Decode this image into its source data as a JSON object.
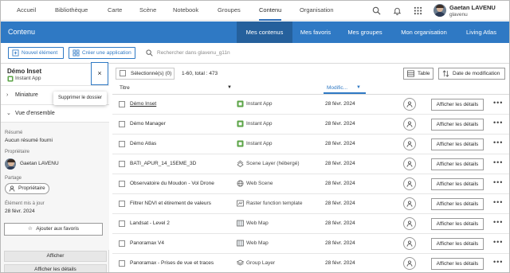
{
  "topnav": {
    "items": [
      {
        "label": "Accueil"
      },
      {
        "label": "Bibliothèque"
      },
      {
        "label": "Carte"
      },
      {
        "label": "Scène"
      },
      {
        "label": "Notebook"
      },
      {
        "label": "Groupes"
      },
      {
        "label": "Contenu"
      },
      {
        "label": "Organisation"
      }
    ],
    "active": "Contenu",
    "user_name": "Gaetan LAVENU",
    "user_org": "glavenu",
    "icons": [
      "search-icon",
      "bell-icon",
      "apps-grid-icon"
    ]
  },
  "header": {
    "title": "Contenu",
    "tabs": [
      {
        "label": "Mes contenus"
      },
      {
        "label": "Mes favoris"
      },
      {
        "label": "Mes groupes"
      },
      {
        "label": "Mon organisation"
      },
      {
        "label": "Living Atlas"
      }
    ],
    "active_tab": "Mes contenus",
    "accent": "#2f79c4"
  },
  "toolbar": {
    "new_item": "Nouvel élément",
    "create_app": "Créer une application",
    "search_placeholder": "Rechercher dans glavenu_g11n"
  },
  "details": {
    "item_title": "Démo Inset",
    "item_type": "Instant App",
    "close_glyph": "×",
    "tooltip": "Supprimer le dossier",
    "thumbnail_label": "Miniature",
    "overview_label": "Vue d'ensemble",
    "summary_label": "Résumé",
    "summary_value": "Aucun résumé fourni",
    "owner_label": "Propriétaire",
    "owner_value": "Gaetan LAVENU",
    "sharing_label": "Partage",
    "sharing_value": "Propriétaire",
    "updated_label": "Élément mis à jour",
    "updated_value": "28 févr. 2024",
    "favorite_button": "Ajouter aux favoris",
    "open_button": "Afficher",
    "details_button": "Afficher les détails"
  },
  "table": {
    "selected_label": "Sélectionné(s) (0)",
    "range_label": "1-60, total : 473",
    "view_button": "Table",
    "sort_button": "Date de modification",
    "col_title": "Titre",
    "col_modified": "Modific...",
    "row_button": "Afficher les détails",
    "rows": [
      {
        "title": "Démo Inset",
        "type": "Instant App",
        "icon": "instant-app-icon",
        "date": "28 févr. 2024"
      },
      {
        "title": "Démo Manager",
        "type": "Instant App",
        "icon": "instant-app-icon",
        "date": "28 févr. 2024"
      },
      {
        "title": "Démo Atlas",
        "type": "Instant App",
        "icon": "instant-app-icon",
        "date": "28 févr. 2024"
      },
      {
        "title": "BATI_APUR_14_15EME_3D",
        "type": "Scene Layer (hébergé)",
        "icon": "scene-layer-icon",
        "date": "28 févr. 2024"
      },
      {
        "title": "Observatoire du Moudon - Vol Drone",
        "type": "Web Scene",
        "icon": "web-scene-icon",
        "date": "28 févr. 2024"
      },
      {
        "title": "Filtrer NDVI et étirement de valeurs",
        "type": "Raster function template",
        "icon": "raster-function-icon",
        "date": "28 févr. 2024"
      },
      {
        "title": "Landsat - Level 2",
        "type": "Web Map",
        "icon": "web-map-icon",
        "date": "28 févr. 2024"
      },
      {
        "title": "Panoramax V4",
        "type": "Web Map",
        "icon": "web-map-icon",
        "date": "28 févr. 2024"
      },
      {
        "title": "Panoramax - Prises de vue et traces",
        "type": "Group Layer",
        "icon": "group-layer-icon",
        "date": "28 févr. 2024"
      }
    ]
  }
}
